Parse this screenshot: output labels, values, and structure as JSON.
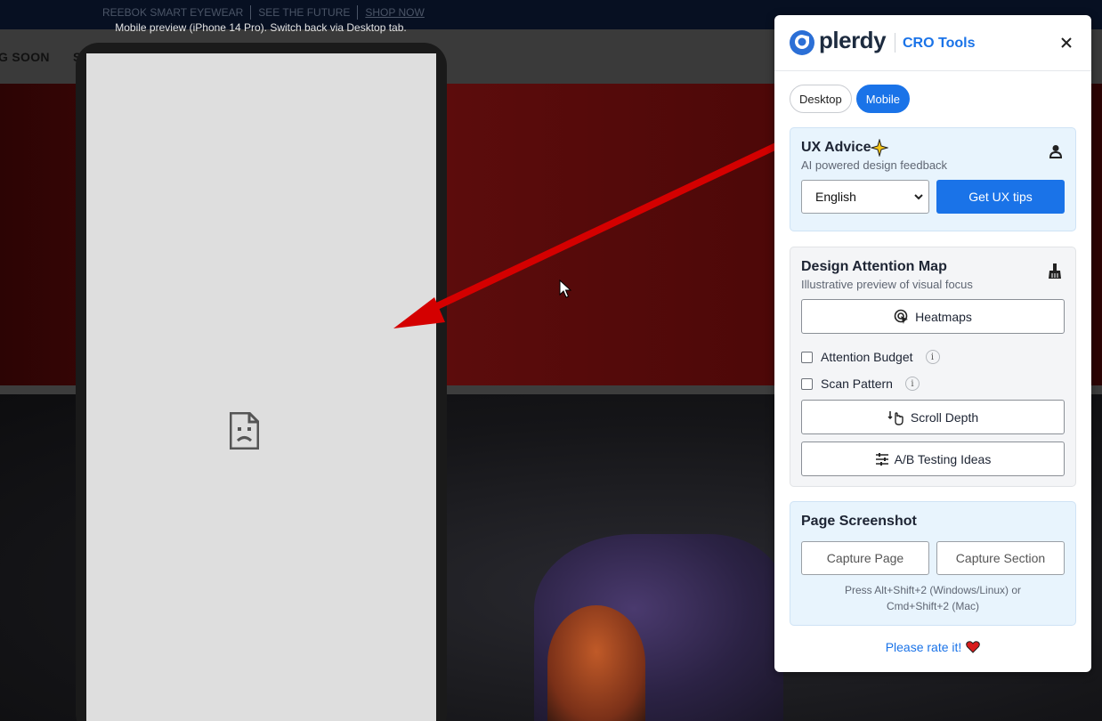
{
  "background": {
    "promo_links": [
      "REEBOK SMART EYEWEAR",
      "SEE THE FUTURE",
      "SHOP NOW"
    ],
    "nav_items": [
      "G SOON",
      "S"
    ],
    "preview_note": "Mobile preview (iPhone 14 Pro). Switch back via Desktop tab."
  },
  "panel": {
    "logo": "plerdy",
    "subtitle": "CRO Tools",
    "tabs": [
      {
        "label": "Desktop",
        "active": false
      },
      {
        "label": "Mobile",
        "active": true
      }
    ],
    "ux_advice": {
      "title": "UX Advice",
      "subtitle": "AI powered design feedback",
      "language": "English",
      "button": "Get UX tips"
    },
    "attention_map": {
      "title": "Design Attention Map",
      "subtitle": "Illustrative preview of visual focus",
      "heatmaps": "Heatmaps",
      "attention_budget": "Attention Budget",
      "scan_pattern": "Scan Pattern",
      "scroll_depth": "Scroll Depth",
      "ab_testing": "A/B Testing Ideas"
    },
    "screenshot": {
      "title": "Page Screenshot",
      "capture_page": "Capture Page",
      "capture_section": "Capture Section",
      "hint_line1": "Press Alt+Shift+2 (Windows/Linux) or",
      "hint_line2": "Cmd+Shift+2 (Mac)"
    },
    "rate": "Please rate it!"
  },
  "colors": {
    "accent": "#1a73e8",
    "arrow": "#d40000"
  }
}
